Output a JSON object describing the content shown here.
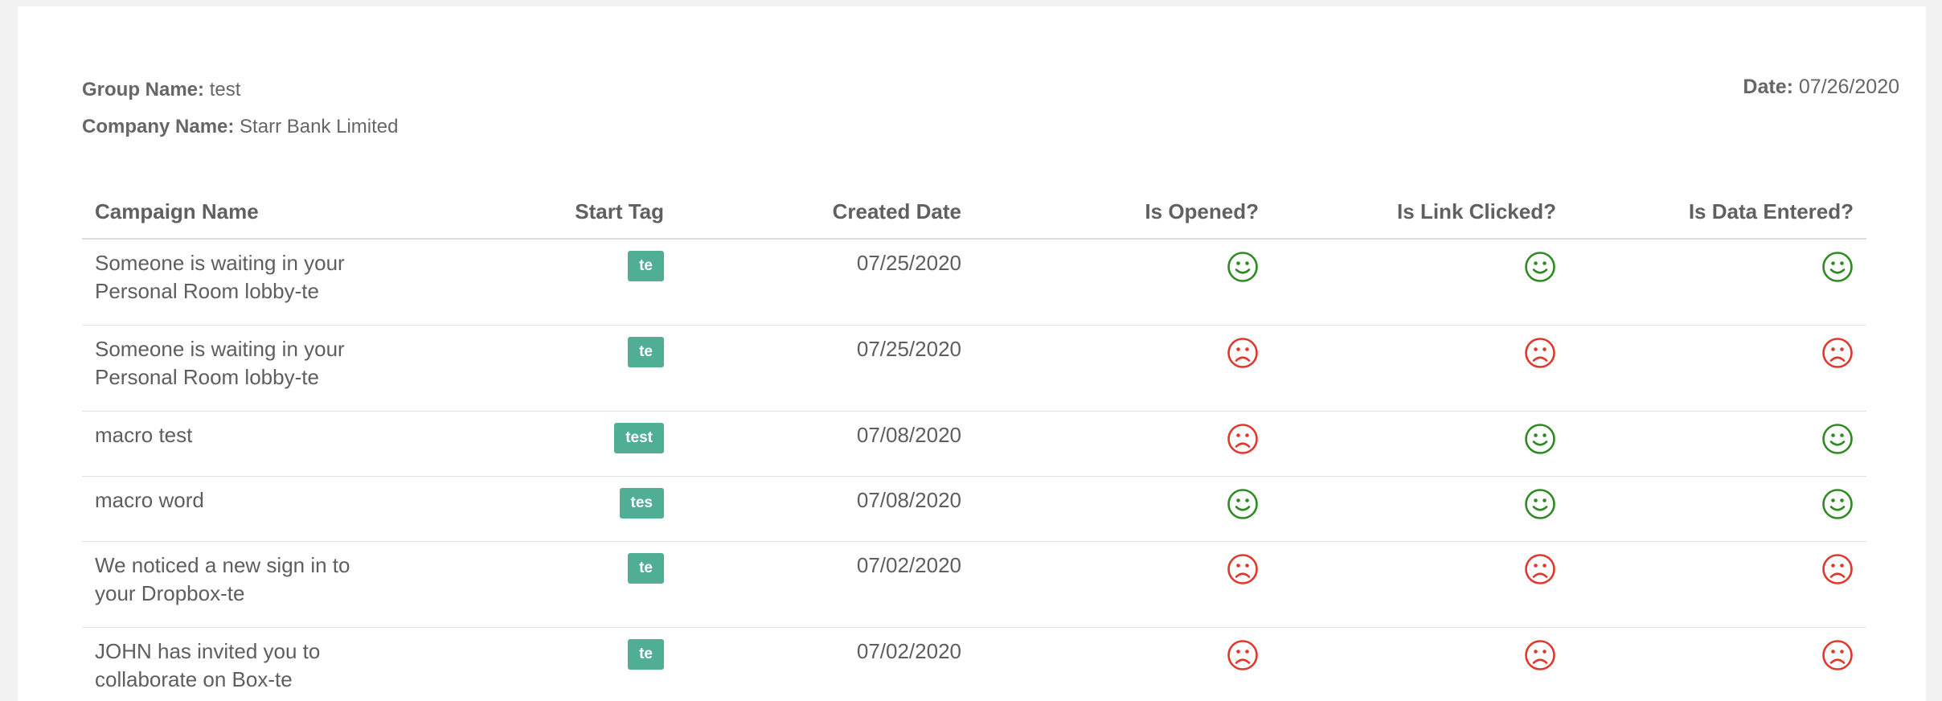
{
  "header": {
    "group_label": "Group Name:",
    "group_value": "test",
    "company_label": "Company Name:",
    "company_value": "Starr Bank Limited",
    "date_label": "Date:",
    "date_value": "07/26/2020"
  },
  "table": {
    "columns": [
      "Campaign Name",
      "Start Tag",
      "Created Date",
      "Is Opened?",
      "Is Link Clicked?",
      "Is Data Entered?"
    ],
    "rows": [
      {
        "name": "Someone is waiting in your Personal Room lobby-te",
        "tag": "te",
        "created": "07/25/2020",
        "opened": "yes",
        "clicked": "yes",
        "entered": "yes"
      },
      {
        "name": "Someone is waiting in your Personal Room lobby-te",
        "tag": "te",
        "created": "07/25/2020",
        "opened": "no",
        "clicked": "no",
        "entered": "no"
      },
      {
        "name": "macro test",
        "tag": "test",
        "created": "07/08/2020",
        "opened": "no",
        "clicked": "yes",
        "entered": "yes"
      },
      {
        "name": "macro word",
        "tag": "tes",
        "created": "07/08/2020",
        "opened": "yes",
        "clicked": "yes",
        "entered": "yes"
      },
      {
        "name": "We noticed a new sign in to your Dropbox-te",
        "tag": "te",
        "created": "07/02/2020",
        "opened": "no",
        "clicked": "no",
        "entered": "no"
      },
      {
        "name": "JOHN has invited you to collaborate on Box-te",
        "tag": "te",
        "created": "07/02/2020",
        "opened": "no",
        "clicked": "no",
        "entered": "no"
      }
    ]
  },
  "icons": {
    "yes": "smile-icon",
    "no": "frown-icon"
  },
  "colors": {
    "tag": "#4fae93",
    "yes": "#2e8b22",
    "no": "#e0382b"
  }
}
